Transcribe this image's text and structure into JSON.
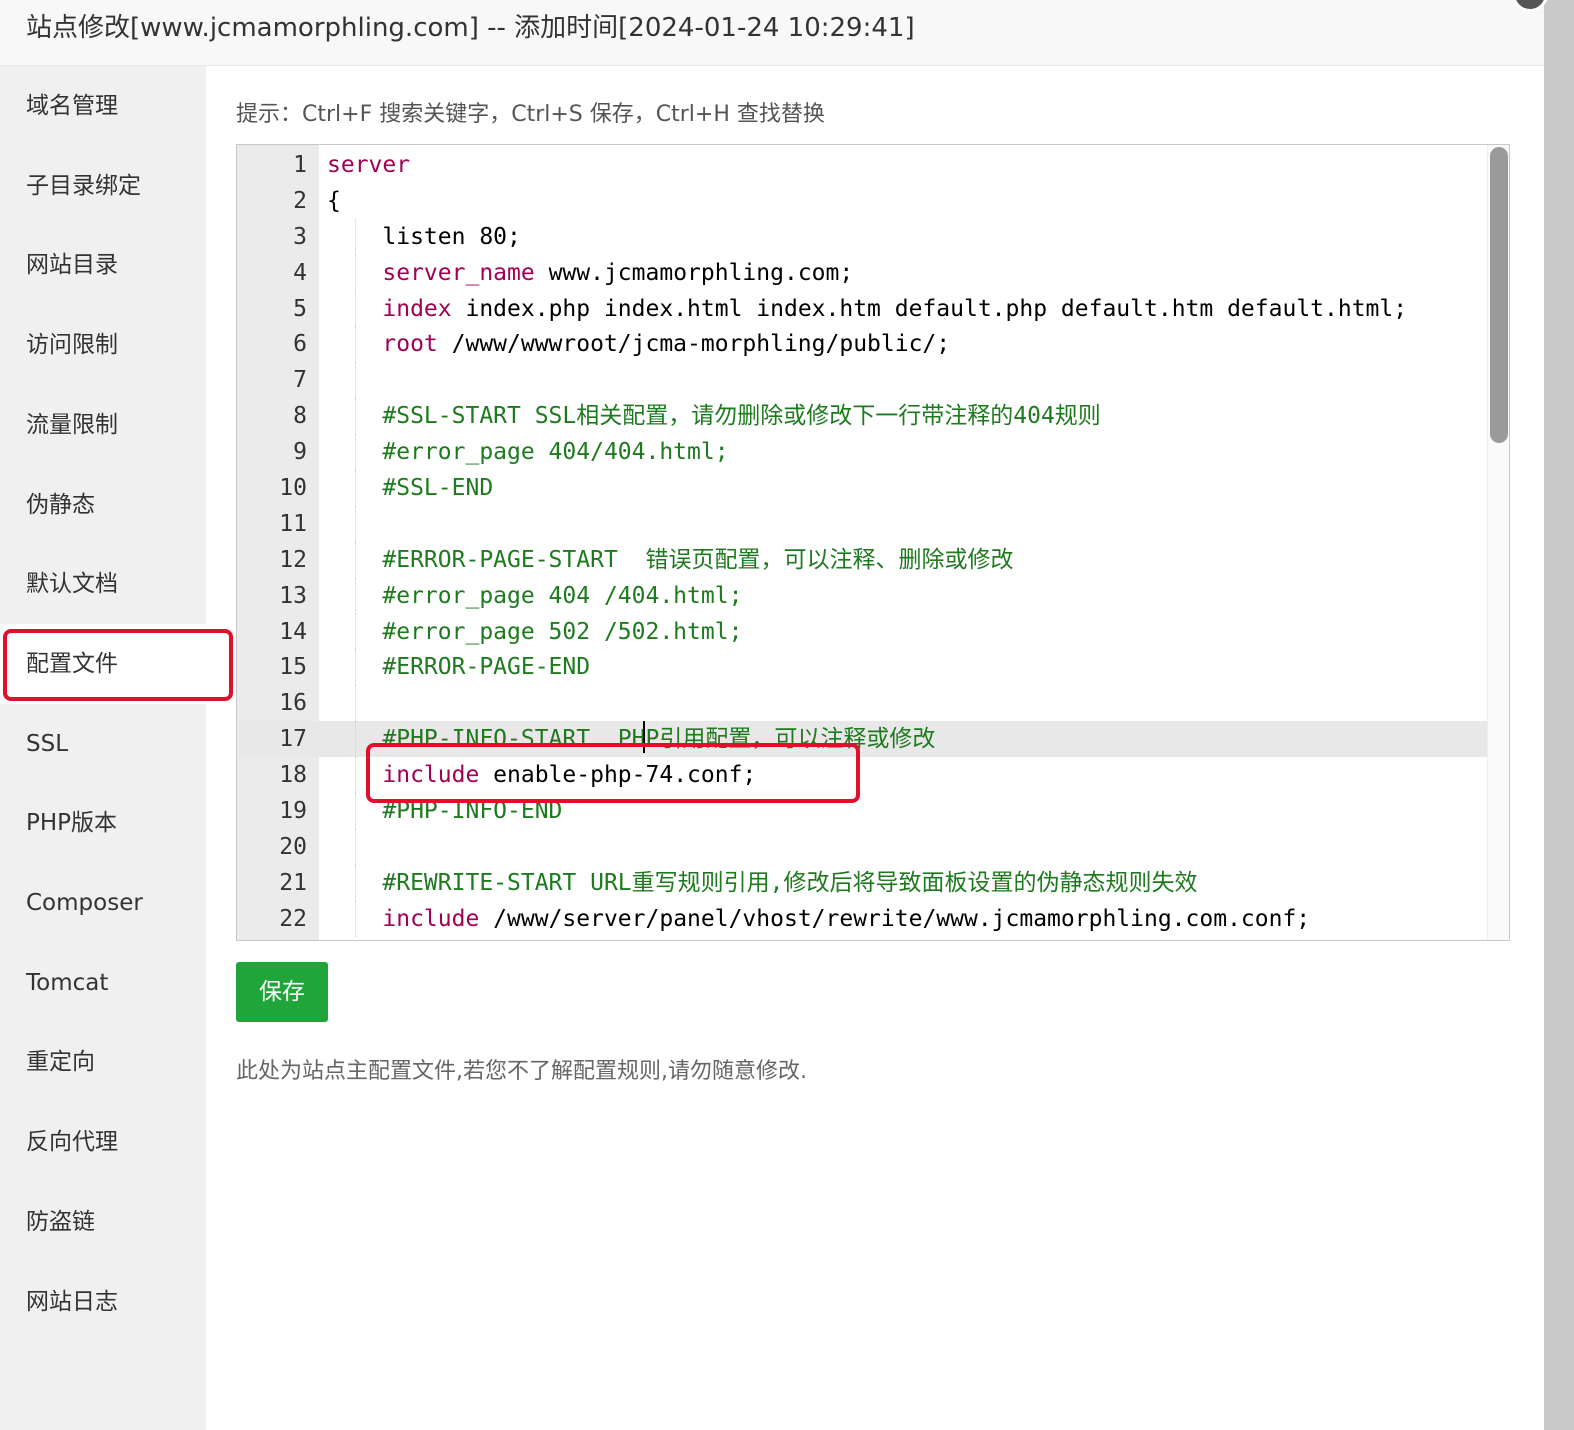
{
  "window": {
    "title": "站点修改[www.jcmamorphling.com] -- 添加时间[2024-01-24 10:29:41]"
  },
  "sidebar": {
    "items": [
      {
        "label": "域名管理"
      },
      {
        "label": "子目录绑定"
      },
      {
        "label": "网站目录"
      },
      {
        "label": "访问限制"
      },
      {
        "label": "流量限制"
      },
      {
        "label": "伪静态"
      },
      {
        "label": "默认文档"
      },
      {
        "label": "配置文件",
        "active": true
      },
      {
        "label": "SSL"
      },
      {
        "label": "PHP版本"
      },
      {
        "label": "Composer"
      },
      {
        "label": "Tomcat"
      },
      {
        "label": "重定向"
      },
      {
        "label": "反向代理"
      },
      {
        "label": "防盗链"
      },
      {
        "label": "网站日志"
      }
    ]
  },
  "editor": {
    "hint": "提示：Ctrl+F 搜索关键字，Ctrl+S 保存，Ctrl+H 查找替换",
    "active_line": 17,
    "lines": [
      {
        "n": "1",
        "parts": [
          {
            "t": "server",
            "c": "kw2"
          }
        ]
      },
      {
        "n": "2",
        "parts": [
          {
            "t": "{",
            "c": "plain"
          }
        ]
      },
      {
        "n": "3",
        "parts": [
          {
            "t": "    listen 80;",
            "c": "plain"
          }
        ]
      },
      {
        "n": "4",
        "parts": [
          {
            "t": "    ",
            "c": "plain"
          },
          {
            "t": "server_name",
            "c": "kw2"
          },
          {
            "t": " www.jcmamorphling.com;",
            "c": "plain"
          }
        ]
      },
      {
        "n": "5",
        "parts": [
          {
            "t": "    ",
            "c": "plain"
          },
          {
            "t": "index",
            "c": "kw2"
          },
          {
            "t": " index.php index.html index.htm default.php default.htm default.html;",
            "c": "plain"
          }
        ]
      },
      {
        "n": "6",
        "parts": [
          {
            "t": "    ",
            "c": "plain"
          },
          {
            "t": "root",
            "c": "kw2"
          },
          {
            "t": " /www/wwwroot/jcma-morphling/public/;",
            "c": "plain"
          }
        ]
      },
      {
        "n": "7",
        "parts": [
          {
            "t": "",
            "c": "plain"
          }
        ]
      },
      {
        "n": "8",
        "parts": [
          {
            "t": "    #SSL-START SSL相关配置，请勿删除或修改下一行带注释的404规则",
            "c": "cmt"
          }
        ]
      },
      {
        "n": "9",
        "parts": [
          {
            "t": "    #error_page 404/404.html;",
            "c": "cmt"
          }
        ]
      },
      {
        "n": "10",
        "parts": [
          {
            "t": "    #SSL-END",
            "c": "cmt"
          }
        ]
      },
      {
        "n": "11",
        "parts": [
          {
            "t": "",
            "c": "plain"
          }
        ]
      },
      {
        "n": "12",
        "parts": [
          {
            "t": "    #ERROR-PAGE-START  错误页配置，可以注释、删除或修改",
            "c": "cmt"
          }
        ]
      },
      {
        "n": "13",
        "parts": [
          {
            "t": "    #error_page 404 /404.html;",
            "c": "cmt"
          }
        ]
      },
      {
        "n": "14",
        "parts": [
          {
            "t": "    #error_page 502 /502.html;",
            "c": "cmt"
          }
        ]
      },
      {
        "n": "15",
        "parts": [
          {
            "t": "    #ERROR-PAGE-END",
            "c": "cmt"
          }
        ]
      },
      {
        "n": "16",
        "parts": [
          {
            "t": "",
            "c": "plain"
          }
        ]
      },
      {
        "n": "17",
        "parts": [
          {
            "t": "    #PHP-INFO-START  PHP引用配置，可以注释或修改",
            "c": "cmt"
          }
        ]
      },
      {
        "n": "18",
        "parts": [
          {
            "t": "    ",
            "c": "plain"
          },
          {
            "t": "include",
            "c": "kw2"
          },
          {
            "t": " enable-php-74.conf;",
            "c": "plain"
          }
        ]
      },
      {
        "n": "19",
        "parts": [
          {
            "t": "    #PHP-INFO-END",
            "c": "cmt"
          }
        ]
      },
      {
        "n": "20",
        "parts": [
          {
            "t": "",
            "c": "plain"
          }
        ]
      },
      {
        "n": "21",
        "parts": [
          {
            "t": "    #REWRITE-START URL重写规则引用,修改后将导致面板设置的伪静态规则失效",
            "c": "cmt"
          }
        ]
      },
      {
        "n": "22",
        "parts": [
          {
            "t": "    ",
            "c": "plain"
          },
          {
            "t": "include",
            "c": "kw2"
          },
          {
            "t": " /www/server/panel/vhost/rewrite/www.jcmamorphling.com.conf;",
            "c": "plain"
          }
        ]
      }
    ]
  },
  "actions": {
    "save_label": "保存"
  },
  "footer": {
    "note": "此处为站点主配置文件,若您不了解配置规则,请勿随意修改."
  },
  "colors": {
    "accent_green": "#20a53a",
    "highlight_red": "#e0102a",
    "comment_green": "#1e7a1e",
    "keyword": "#a10054"
  }
}
